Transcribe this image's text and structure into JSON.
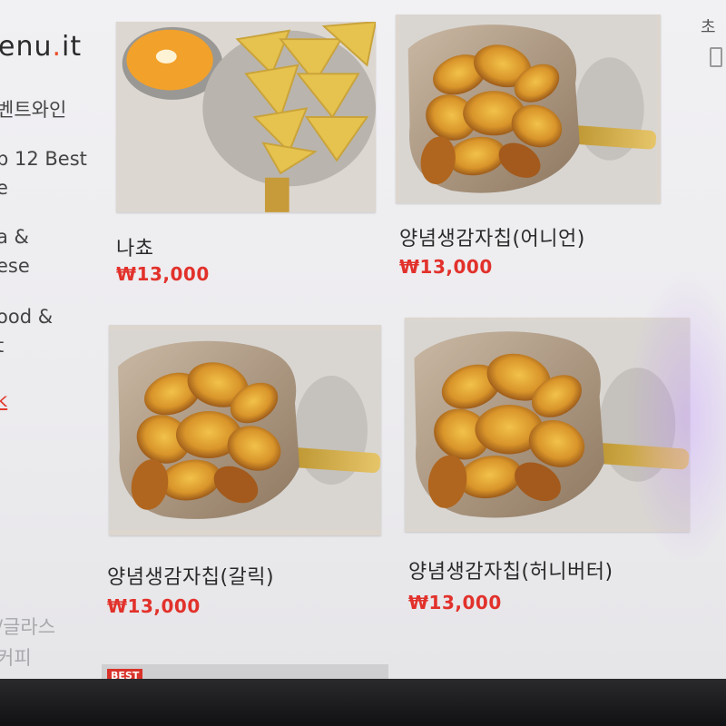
{
  "sidebar": {
    "logo_main": "enu",
    "logo_dot": ".",
    "logo_suffix": "it",
    "items": [
      {
        "label": "벤트와인"
      },
      {
        "label": "p 12 Best"
      },
      {
        "label": "e"
      },
      {
        "label": "a &"
      },
      {
        "label": "ese"
      },
      {
        "label": "ood &"
      },
      {
        "label": "t"
      },
      {
        "label": "k"
      },
      {
        "label": "/글라스"
      },
      {
        "label": "커피"
      }
    ]
  },
  "right_edge": {
    "char": "초"
  },
  "products": [
    {
      "name": "나쵸",
      "price": "₩13,000",
      "image": "nachos-photo"
    },
    {
      "name": "양념생감자칩(어니언)",
      "price": "₩13,000",
      "image": "potato-chips-photo"
    },
    {
      "name": "양념생감자칩(갈릭)",
      "price": "₩13,000",
      "image": "potato-chips-photo"
    },
    {
      "name": "양념생감자칩(허니버터)",
      "price": "₩13,000",
      "image": "potato-chips-photo"
    }
  ],
  "best_badge": "BEST",
  "colors": {
    "accent": "#e2312b",
    "logo_dot": "#e8502a"
  }
}
